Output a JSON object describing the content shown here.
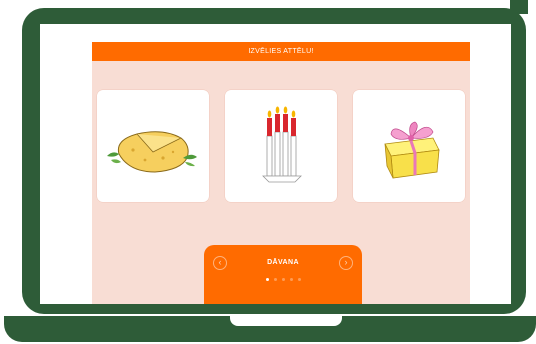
{
  "header": {
    "title": "IZVĒLIES ATTĒLU!"
  },
  "cards": [
    {
      "icon": "cheese-icon"
    },
    {
      "icon": "candles-icon"
    },
    {
      "icon": "gift-icon"
    }
  ],
  "word": {
    "text": "DĀVANA"
  },
  "navigation": {
    "prev_icon": "chevron-left-icon",
    "next_icon": "chevron-right-icon"
  },
  "pagination": {
    "total": 5,
    "active_index": 0
  },
  "colors": {
    "accent": "#ff6b00",
    "background": "#f8ddd4",
    "frame": "#2e5c38"
  }
}
